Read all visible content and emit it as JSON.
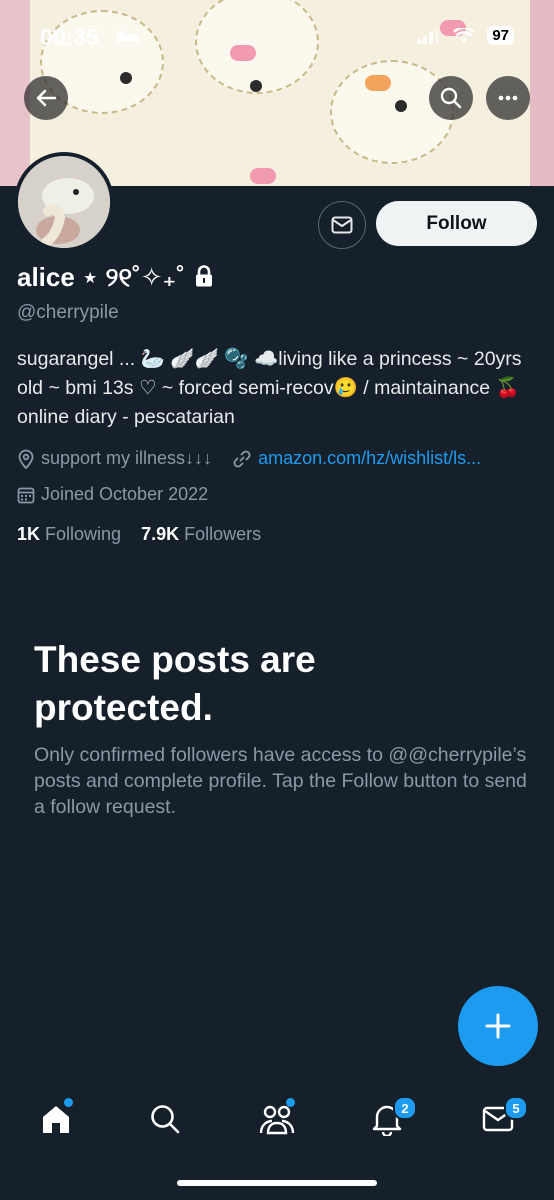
{
  "status_bar": {
    "time": "00:35",
    "battery": "97"
  },
  "profile": {
    "name": "alice ⋆ ୨୧˚✧₊˚",
    "handle": "@cherrypile",
    "bio": "sugarangel ... 🦢 🪽🪽 🫧 ☁️living like a princess ~ 20yrs old ~ bmi 13s ♡ ~ forced semi-recov🥲 / maintainance 🍒 online diary - pescatarian",
    "location": "support my illness↓↓↓",
    "website": "amazon.com/hz/wishlist/ls...",
    "joined": "Joined October 2022",
    "following_count": "1K",
    "following_label": "Following",
    "followers_count": "7.9K",
    "followers_label": "Followers"
  },
  "actions": {
    "follow_label": "Follow"
  },
  "protected": {
    "title": "These posts are protected.",
    "body": "Only confirmed followers have access to @@cherrypile’s posts and complete profile. Tap the Follow button to send a follow request."
  },
  "tabbar": {
    "notifications_badge": "2",
    "messages_badge": "5"
  },
  "colors": {
    "accent": "#1d9bf0",
    "background": "#15202b",
    "muted": "#8b98a5"
  }
}
